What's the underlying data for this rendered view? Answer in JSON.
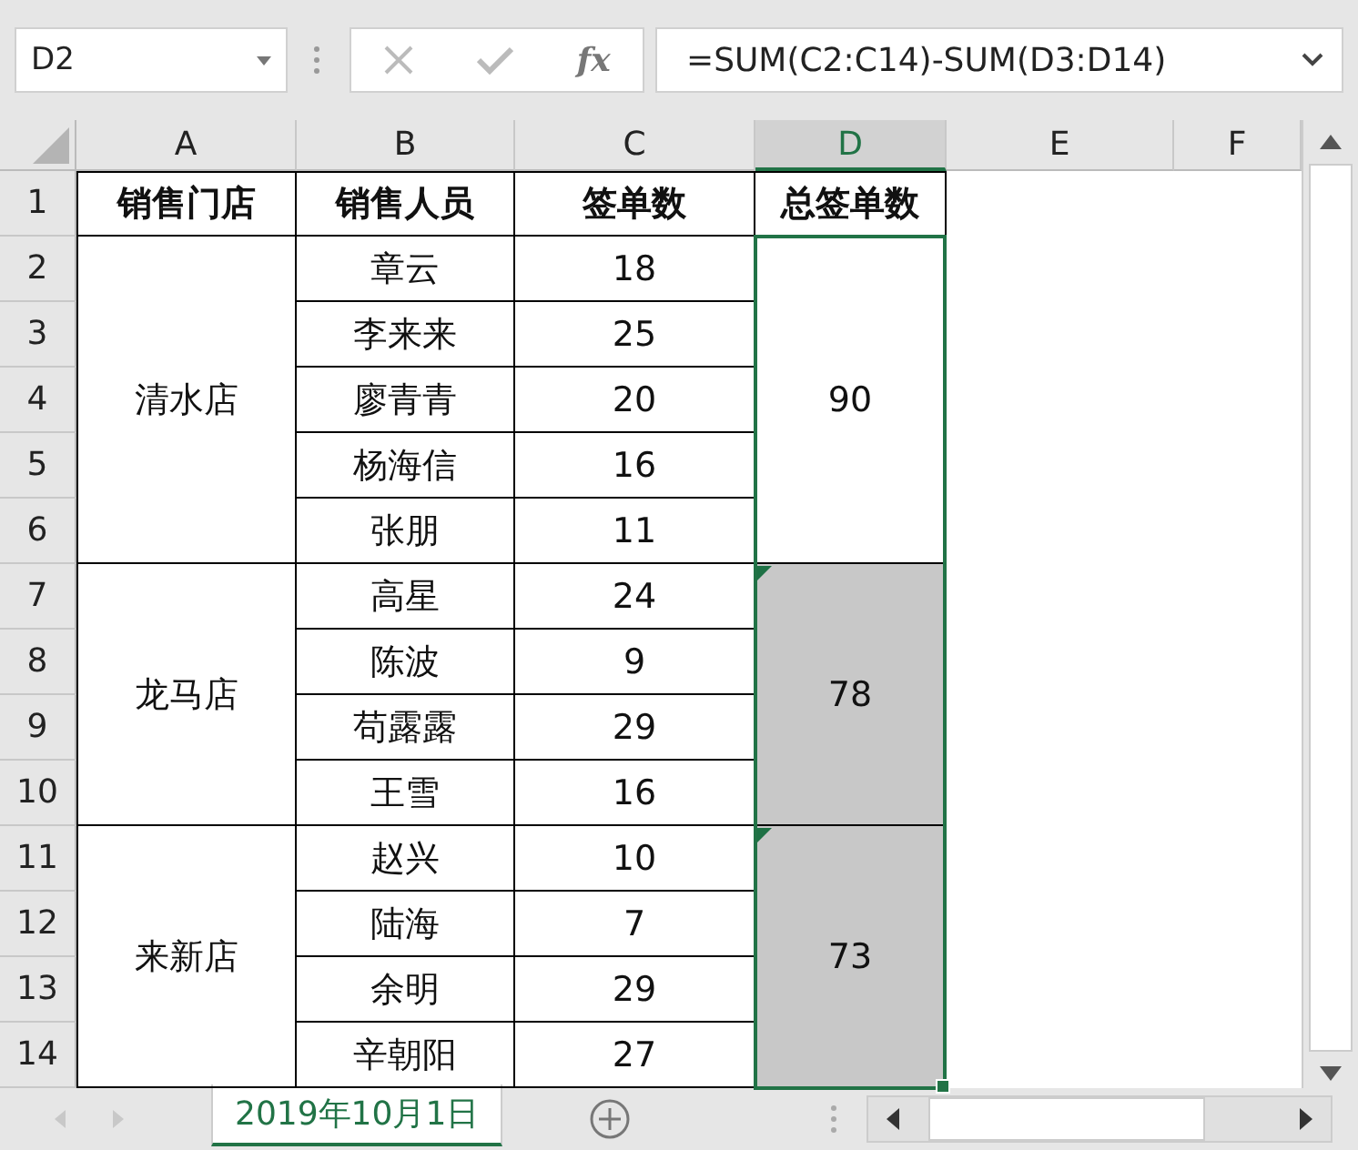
{
  "formula_bar": {
    "name_box": "D2",
    "fx_label": "fx",
    "formula": "=SUM(C2:C14)-SUM(D3:D14)"
  },
  "column_headers": [
    {
      "label": "A",
      "selected": false
    },
    {
      "label": "B",
      "selected": false
    },
    {
      "label": "C",
      "selected": false
    },
    {
      "label": "D",
      "selected": true
    },
    {
      "label": "E",
      "selected": false
    },
    {
      "label": "F",
      "selected": false
    }
  ],
  "row_numbers": [
    "1",
    "2",
    "3",
    "4",
    "5",
    "6",
    "7",
    "8",
    "9",
    "10",
    "11",
    "12",
    "13",
    "14"
  ],
  "table": {
    "headings": [
      "销售门店",
      "销售人员",
      "签单数",
      "总签单数"
    ],
    "stores": [
      {
        "store": "清水店",
        "total": "90",
        "selected": true,
        "active": true,
        "error_indicator": false,
        "people": [
          {
            "name": "章云",
            "count": "18"
          },
          {
            "name": "李来来",
            "count": "25"
          },
          {
            "name": "廖青青",
            "count": "20"
          },
          {
            "name": "杨海信",
            "count": "16"
          },
          {
            "name": "张朋",
            "count": "11"
          }
        ]
      },
      {
        "store": "龙马店",
        "total": "78",
        "selected": true,
        "active": false,
        "error_indicator": true,
        "people": [
          {
            "name": "高星",
            "count": "24"
          },
          {
            "name": "陈波",
            "count": "9"
          },
          {
            "name": "苟露露",
            "count": "29"
          },
          {
            "name": "王雪",
            "count": "16"
          }
        ]
      },
      {
        "store": "来新店",
        "total": "73",
        "selected": true,
        "active": false,
        "error_indicator": true,
        "people": [
          {
            "name": "赵兴",
            "count": "10"
          },
          {
            "name": "陆海",
            "count": "7"
          },
          {
            "name": "余明",
            "count": "29"
          },
          {
            "name": "辛朝阳",
            "count": "27"
          }
        ]
      }
    ]
  },
  "sheet_tabs": [
    {
      "label": "2019年10月1日",
      "selected": true
    }
  ]
}
